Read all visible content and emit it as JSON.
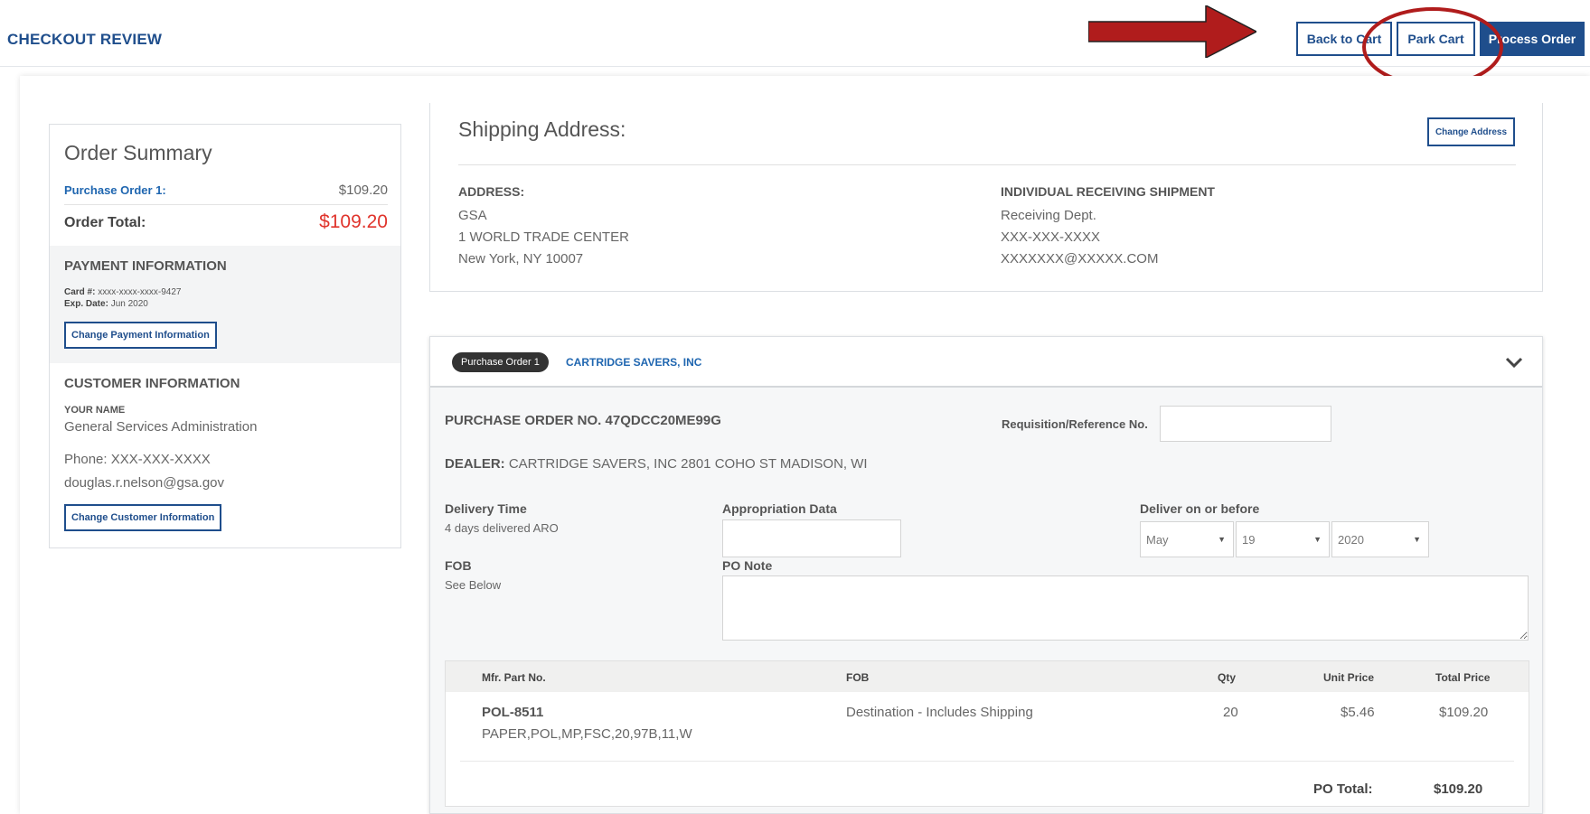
{
  "header": {
    "title": "CHECKOUT REVIEW",
    "back_label": "Back to Cart",
    "park_label": "Park Cart",
    "process_label": "Process Order",
    "annotation_color": "#b01c1c"
  },
  "summary": {
    "title": "Order Summary",
    "po_label": "Purchase Order 1:",
    "po_amount": "$109.20",
    "total_label": "Order Total:",
    "total_amount": "$109.20",
    "payment": {
      "heading": "PAYMENT INFORMATION",
      "card_label": "Card #:",
      "card_value": "xxxx-xxxx-xxxx-9427",
      "exp_label": "Exp. Date:",
      "exp_value": "Jun 2020",
      "change_label": "Change Payment Information"
    },
    "customer": {
      "heading": "CUSTOMER INFORMATION",
      "name_label": "YOUR NAME",
      "name": "General Services Administration",
      "phone": "Phone: XXX-XXX-XXXX",
      "email": "douglas.r.nelson@gsa.gov",
      "change_label": "Change Customer Information"
    }
  },
  "shipping": {
    "title": "Shipping Address:",
    "change_label": "Change Address",
    "address_heading": "ADDRESS:",
    "address_lines": [
      "GSA",
      "1 WORLD TRADE CENTER",
      "New York, NY 10007"
    ],
    "receiver_heading": "INDIVIDUAL RECEIVING SHIPMENT",
    "receiver_lines": [
      "Receiving Dept.",
      "XXX-XXX-XXXX",
      "XXXXXXX@XXXXX.COM"
    ]
  },
  "purchase_order": {
    "pill": "Purchase Order 1",
    "vendor": "CARTRIDGE SAVERS, INC",
    "po_number": "PURCHASE ORDER NO. 47QDCC20ME99G",
    "req_label": "Requisition/Reference No.",
    "dealer_label": "DEALER:",
    "dealer_value": "CARTRIDGE SAVERS, INC 2801 COHO ST MADISON, WI",
    "delivery_time_label": "Delivery Time",
    "delivery_time_value": "4 days delivered ARO",
    "approp_label": "Appropriation Data",
    "deliver_by_label": "Deliver on or before",
    "month": "May",
    "day": "19",
    "year": "2020",
    "fob_label": "FOB",
    "fob_value": "See Below",
    "po_note_label": "PO Note"
  },
  "items_table": {
    "columns": [
      "Mfr. Part No.",
      "FOB",
      "Qty",
      "Unit Price",
      "Total Price"
    ],
    "rows": [
      {
        "part_no": "POL-8511",
        "description": "PAPER,POL,MP,FSC,20,97B,11,W",
        "fob": "Destination - Includes Shipping",
        "qty": "20",
        "unit_price": "$5.46",
        "total_price": "$109.20"
      }
    ],
    "po_total_label": "PO Total:",
    "po_total_amount": "$109.20"
  }
}
